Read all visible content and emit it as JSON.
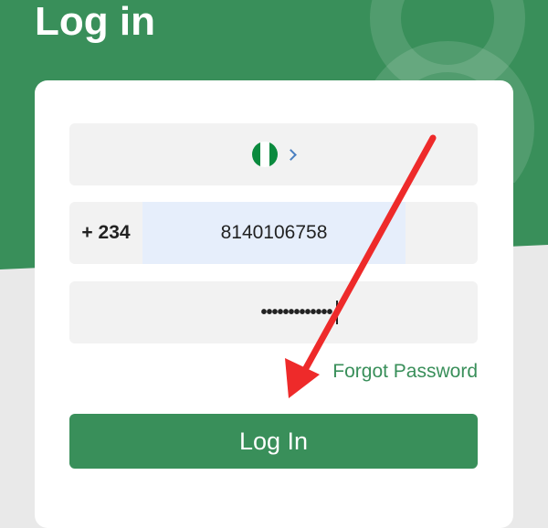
{
  "header": {
    "title": "Log in"
  },
  "form": {
    "country": {
      "flag_icon": "nigeria-flag-icon",
      "chevron_icon": "chevron-right-icon"
    },
    "phone": {
      "prefix": "+ 234",
      "value": "8140106758"
    },
    "password": {
      "value": "•••••••••••••"
    },
    "forgot_label": "Forgot Password",
    "login_label": "Log In"
  },
  "colors": {
    "brand_green": "#398f5a",
    "phone_highlight": "#e6eefb",
    "annotation_arrow": "#ee2a2a"
  },
  "annotation": {
    "arrow_icon": "red-arrow-icon"
  }
}
